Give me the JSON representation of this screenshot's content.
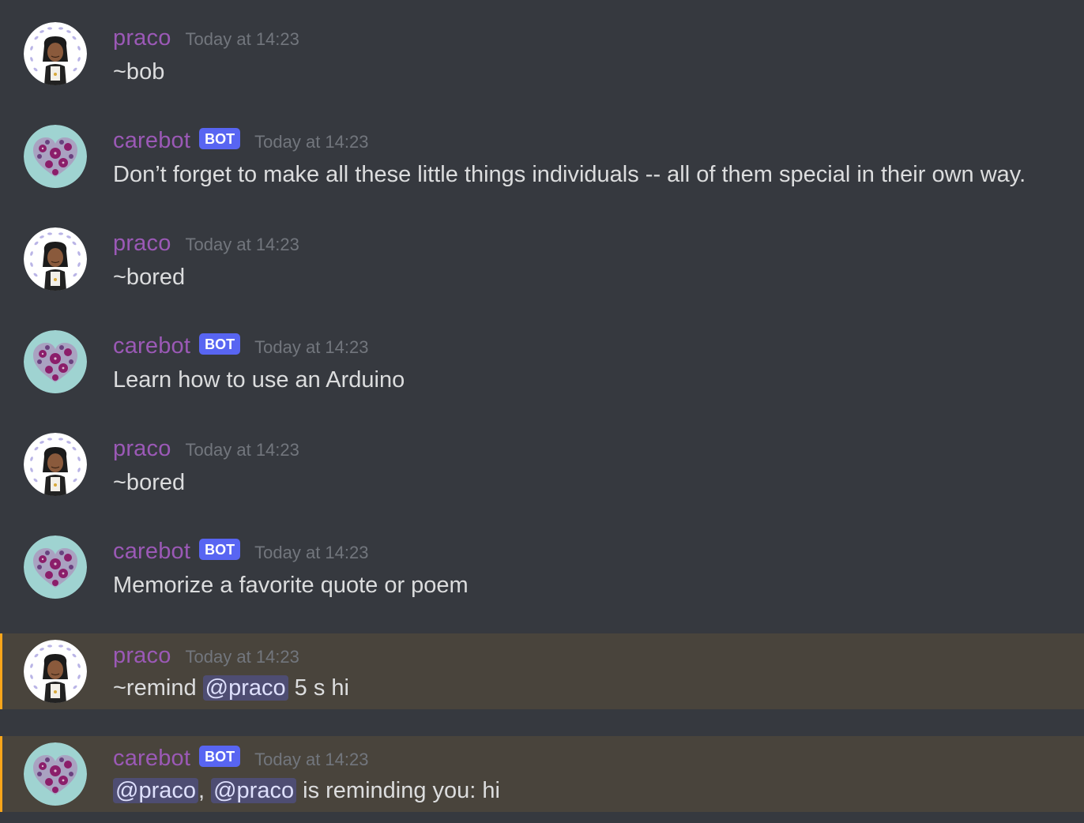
{
  "messages": [
    {
      "user": "praco",
      "is_bot": false,
      "timestamp": "Today at 14:23",
      "text": "~bob"
    },
    {
      "user": "carebot",
      "is_bot": true,
      "bot_tag": "BOT",
      "timestamp": "Today at 14:23",
      "text": "Don’t forget to make all these little things individuals -- all of them special in their own way."
    },
    {
      "user": "praco",
      "is_bot": false,
      "timestamp": "Today at 14:23",
      "text": "~bored"
    },
    {
      "user": "carebot",
      "is_bot": true,
      "bot_tag": "BOT",
      "timestamp": "Today at 14:23",
      "text": "Learn how to use an Arduino"
    },
    {
      "user": "praco",
      "is_bot": false,
      "timestamp": "Today at 14:23",
      "text": "~bored"
    },
    {
      "user": "carebot",
      "is_bot": true,
      "bot_tag": "BOT",
      "timestamp": "Today at 14:23",
      "text": "Memorize a favorite quote or poem"
    },
    {
      "user": "praco",
      "is_bot": false,
      "timestamp": "Today at 14:23",
      "text_before": "~remind ",
      "mention": "@praco",
      "text_after": " 5 s hi"
    },
    {
      "user": "carebot",
      "is_bot": true,
      "bot_tag": "BOT",
      "timestamp": "Today at 14:23",
      "mention1": "@praco",
      "sep": ", ",
      "mention2": "@praco",
      "text_after": " is reminding you: hi"
    }
  ],
  "colors": {
    "background": "#36393f",
    "username": "#9b59b6",
    "bot_tag": "#5865f2",
    "timestamp": "#72767d",
    "text": "#dcddde",
    "mention_highlight": "#49443c",
    "mention_bar": "#faa61a"
  },
  "icons": {
    "praco_avatar": "user-avatar-icon",
    "carebot_avatar": "heart-flowers-avatar-icon"
  }
}
